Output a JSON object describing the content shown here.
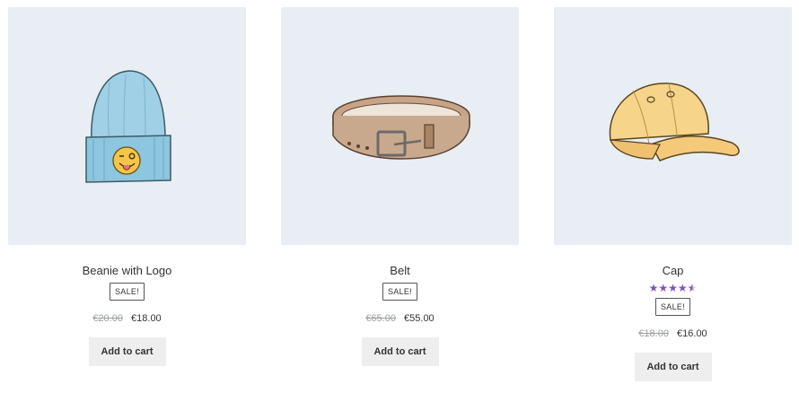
{
  "products": [
    {
      "image_icon": "beanie-image",
      "title": "Beanie with Logo",
      "badge": "SALE!",
      "old_price": "€20.00",
      "new_price": "€18.00",
      "button": "Add to cart"
    },
    {
      "image_icon": "belt-image",
      "title": "Belt",
      "badge": "SALE!",
      "old_price": "€65.00",
      "new_price": "€55.00",
      "button": "Add to cart"
    },
    {
      "image_icon": "cap-image",
      "title": "Cap",
      "rating": 4.5,
      "badge": "SALE!",
      "old_price": "€18.00",
      "new_price": "€16.00",
      "button": "Add to cart"
    }
  ],
  "colors": {
    "image_bg": "#e8eef3",
    "accent_star": "#7f54b3",
    "button_bg": "#eeeeee"
  }
}
